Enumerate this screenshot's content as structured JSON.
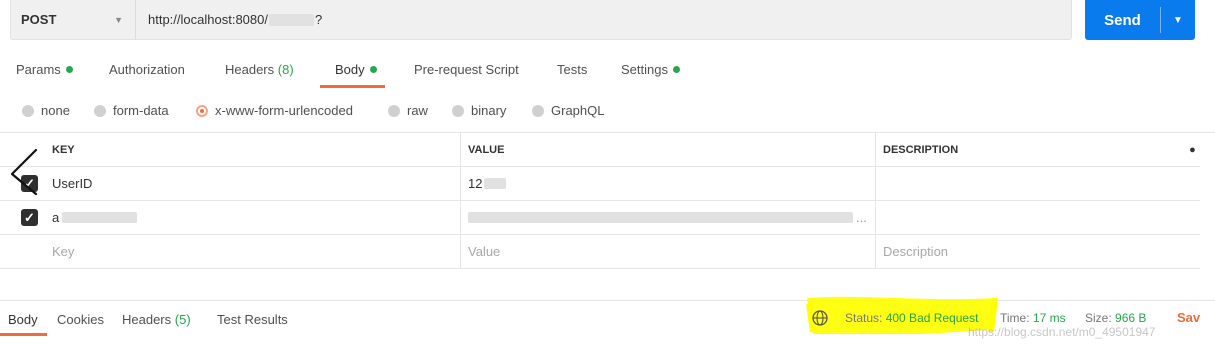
{
  "request": {
    "method": "POST",
    "url_prefix": "http://localhost:8080/",
    "url_suffix": "?",
    "send_label": "Send"
  },
  "tabs": {
    "params": "Params",
    "authorization": "Authorization",
    "headers": "Headers",
    "headers_count": "(8)",
    "body": "Body",
    "prerequest": "Pre-request Script",
    "tests": "Tests",
    "settings": "Settings"
  },
  "body_types": {
    "none": "none",
    "form_data": "form-data",
    "urlencoded": "x-www-form-urlencoded",
    "raw": "raw",
    "binary": "binary",
    "graphql": "GraphQL",
    "selected": "x-www-form-urlencoded"
  },
  "table": {
    "headers": {
      "key": "KEY",
      "value": "VALUE",
      "description": "DESCRIPTION"
    },
    "rows": [
      {
        "key": "UserID",
        "value": "12",
        "checked": true
      },
      {
        "key": "a",
        "value": "...",
        "checked": true
      }
    ],
    "placeholders": {
      "key": "Key",
      "value": "Value",
      "description": "Description"
    }
  },
  "response": {
    "tabs": {
      "body": "Body",
      "cookies": "Cookies",
      "headers": "Headers",
      "headers_count": "(5)",
      "test_results": "Test Results"
    },
    "status_label": "Status:",
    "status_value": "400 Bad Request",
    "time_label": "Time:",
    "time_value": "17 ms",
    "size_label": "Size:",
    "size_value": "966 B",
    "save_label": "Sav"
  },
  "watermark": "https://blog.csdn.net/m0_49501947",
  "colors": {
    "accent": "#f26b3a",
    "send": "#097bed",
    "green": "#26a74a",
    "highlight": "#ffff00"
  }
}
